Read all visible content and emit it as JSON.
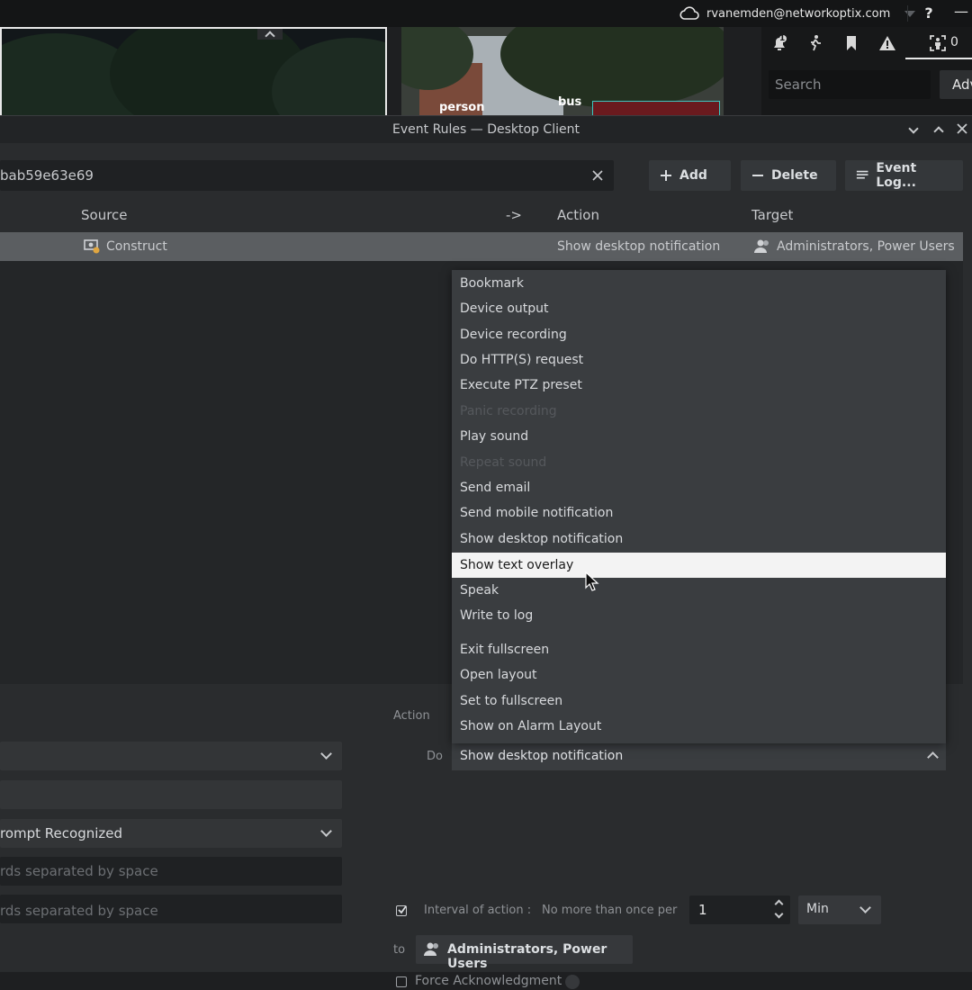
{
  "topbar": {
    "account": "rvanemden@networkoptix.com",
    "help": "?",
    "minimize": "—"
  },
  "video": {
    "labels": [
      "person",
      "bus"
    ]
  },
  "rpanel": {
    "notif_count": "1",
    "tab_trailing": "0",
    "search_placeholder": "Search",
    "adv_label": "Adv"
  },
  "dialog": {
    "title": "Event Rules — Desktop Client",
    "filter_value": "bab59e63e69",
    "buttons": {
      "add": "Add",
      "delete": "Delete",
      "event_log": "Event Log..."
    },
    "columns": {
      "source": "Source",
      "arrow": "->",
      "action": "Action",
      "target": "Target"
    },
    "rule": {
      "source": "Construct",
      "action": "Show desktop notification",
      "target": "Administrators, Power Users"
    }
  },
  "dropdown": {
    "items": [
      {
        "label": "Bookmark",
        "disabled": false
      },
      {
        "label": "Device output",
        "disabled": false
      },
      {
        "label": "Device recording",
        "disabled": false
      },
      {
        "label": "Do HTTP(S) request",
        "disabled": false
      },
      {
        "label": "Execute PTZ preset",
        "disabled": false
      },
      {
        "label": "Panic recording",
        "disabled": true
      },
      {
        "label": "Play sound",
        "disabled": false
      },
      {
        "label": "Repeat sound",
        "disabled": true
      },
      {
        "label": "Send email",
        "disabled": false
      },
      {
        "label": "Send mobile notification",
        "disabled": false
      },
      {
        "label": "Show desktop notification",
        "disabled": false
      },
      {
        "label": "Show text overlay",
        "disabled": false,
        "highlighted": true
      },
      {
        "label": "Speak",
        "disabled": false
      },
      {
        "label": "Write to log",
        "disabled": false
      },
      {
        "label": "Exit fullscreen",
        "disabled": false
      },
      {
        "label": "Open layout",
        "disabled": false
      },
      {
        "label": "Set to fullscreen",
        "disabled": false
      },
      {
        "label": "Show on Alarm Layout",
        "disabled": false
      }
    ]
  },
  "action_panel": {
    "section_label": "Action",
    "do_label": "Do",
    "do_value": "Show desktop notification",
    "interval_label": "Interval of action :",
    "interval_mode": "No more than once per",
    "interval_value": "1",
    "interval_unit": "Min",
    "to_label": "to",
    "to_value": "Administrators, Power Users",
    "force_ack": "Force Acknowledgment"
  },
  "event_panel": {
    "event_value": "rompt Recognized",
    "keywords_ph_1": "rds separated by space",
    "keywords_ph_2": "rds separated by space"
  },
  "colors": {
    "background": "#1e1f21",
    "dialog": "#2a2c2e",
    "row_selected": "#5b5e61",
    "highlight": "#f3f3f3"
  }
}
